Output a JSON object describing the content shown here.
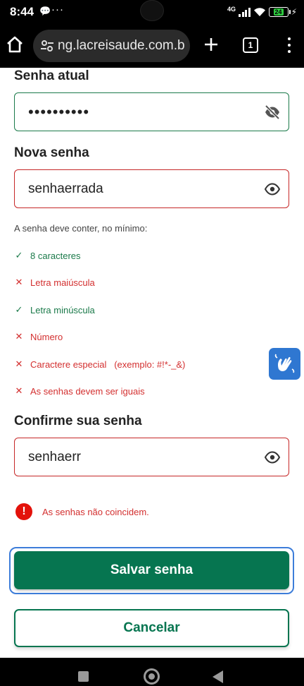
{
  "status_bar": {
    "time": "8:44",
    "notification_icons": [
      "chat-icon",
      "more-dots-icon"
    ],
    "network": "4G",
    "battery_level": "24"
  },
  "browser": {
    "url": "ng.lacreisaude.com.br",
    "tab_count": "1"
  },
  "form": {
    "current_password": {
      "label": "Senha atual",
      "value": "••••••••••"
    },
    "new_password": {
      "label": "Nova senha",
      "value": "senhaerrada"
    },
    "requirements_hint": "A senha deve conter, no mínimo:",
    "requirements": [
      {
        "label": "8 caracteres",
        "met": true
      },
      {
        "label": "Letra maiúscula",
        "met": false
      },
      {
        "label": "Letra minúscula",
        "met": true
      },
      {
        "label": "Número",
        "met": false
      },
      {
        "label": "Caractere especial   (exemplo: #!*-_&)",
        "met": false
      },
      {
        "label": "As senhas devem ser iguais",
        "met": false
      }
    ],
    "confirm_password": {
      "label": "Confirme sua senha",
      "value": "senhaerr"
    },
    "error_message": "As senhas não coincidem.",
    "save_label": "Salvar senha",
    "cancel_label": "Cancelar"
  },
  "colors": {
    "primary": "#067550",
    "success": "#1b7a4a",
    "error": "#d32f2f",
    "focus": "#3d7dd9",
    "accessibility": "#2f77d1"
  }
}
